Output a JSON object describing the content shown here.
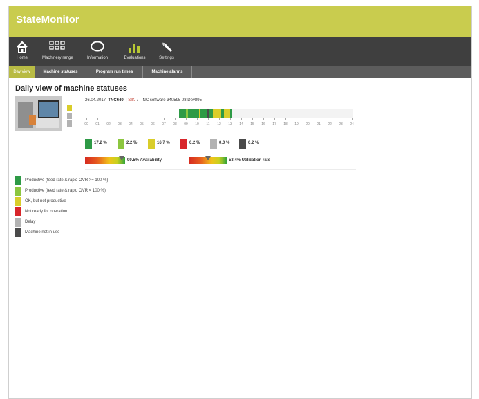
{
  "app": {
    "title": "StateMonitor"
  },
  "nav": [
    {
      "label": "Home",
      "icon": "home-icon"
    },
    {
      "label": "Machinery range",
      "icon": "grid-icon"
    },
    {
      "label": "Information",
      "icon": "speech-bubble-icon"
    },
    {
      "label": "Evaluations",
      "icon": "bar-chart-icon"
    },
    {
      "label": "Settings",
      "icon": "wrench-icon"
    }
  ],
  "tabs": [
    {
      "label": "Day view",
      "active": true
    },
    {
      "label": "Machine statuses",
      "active": false
    },
    {
      "label": "Program run times",
      "active": false
    },
    {
      "label": "Machine alarms",
      "active": false
    }
  ],
  "page": {
    "title": "Daily view of machine statuses"
  },
  "machine": {
    "date": "26.04.2017",
    "model": "TNC640",
    "state": "SIK",
    "sep": "/ |",
    "nc_software": "NC software  340595 08 Dev895"
  },
  "hours": [
    "00",
    "01",
    "02",
    "03",
    "04",
    "05",
    "06",
    "07",
    "08",
    "09",
    "10",
    "11",
    "12",
    "13",
    "14",
    "15",
    "16",
    "17",
    "18",
    "19",
    "20",
    "21",
    "22",
    "23",
    "24"
  ],
  "stats": [
    {
      "value": "17.2 %",
      "color": "#2e9a46"
    },
    {
      "value": "2.2 %",
      "color": "#8cc63f"
    },
    {
      "value": "16.7 %",
      "color": "#d9cd2a"
    },
    {
      "value": "0.2 %",
      "color": "#d8262b"
    },
    {
      "value": "0.0 %",
      "color": "#b3b3b3"
    },
    {
      "value": "0.2 %",
      "color": "#4a4a4a"
    }
  ],
  "kpis": {
    "availability": {
      "label": "99.5% Availability",
      "value": 99.5
    },
    "utilization": {
      "label": "53.4% Utilization rate",
      "value": 53.4
    }
  },
  "legend": [
    {
      "label": "Productive (feed rate & rapid OVR >= 100 %)",
      "color": "#2e9a46"
    },
    {
      "label": "Productive (feed rate & rapid OVR < 100 %)",
      "color": "#8cc63f"
    },
    {
      "label": "OK, but not productive",
      "color": "#d9cd2a"
    },
    {
      "label": "Not ready for operation",
      "color": "#d8262b"
    },
    {
      "label": "Delay",
      "color": "#b3b3b3"
    },
    {
      "label": "Machine not in use",
      "color": "#4a4a4a"
    }
  ],
  "colors": {
    "accent": "#c9cc4e",
    "nav_bg": "#3f3f3f",
    "tab_bg": "#5c5c5c"
  }
}
